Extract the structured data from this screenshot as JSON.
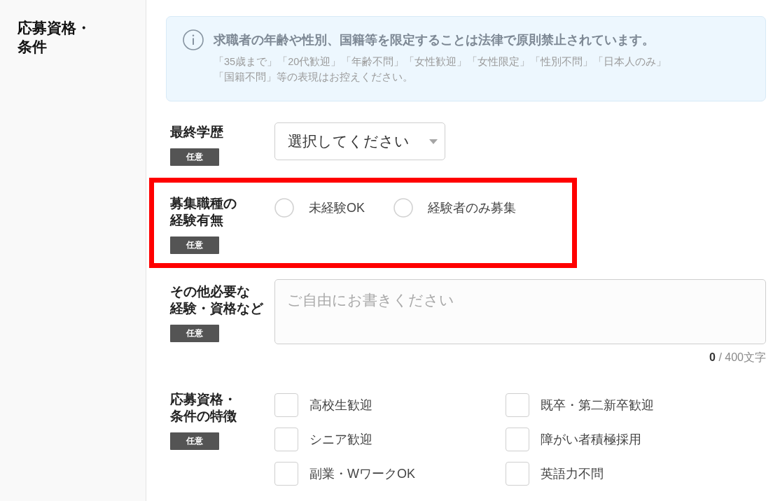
{
  "sidebar": {
    "title": "応募資格・条件"
  },
  "notice": {
    "heading": "求職者の年齢や性別、国籍等を限定することは法律で原則禁止されています。",
    "body": "「35歳まで」「20代歓迎」「年齢不問」「女性歓迎」「女性限定」「性別不問」「日本人のみ」「国籍不問」等の表現はお控えください。"
  },
  "fields": [
    {
      "kind": "select",
      "label_lines": [
        "最終学歴"
      ],
      "badge": "任意",
      "highlighted": false,
      "value": "選択してください"
    },
    {
      "kind": "radio",
      "label_lines": [
        "募集職種の",
        "経験有無"
      ],
      "badge": "任意",
      "highlighted": true,
      "options": [
        {
          "label": "未経験OK",
          "selected": false
        },
        {
          "label": "経験者のみ募集",
          "selected": false
        }
      ]
    },
    {
      "kind": "textarea",
      "label_lines": [
        "その他必要な",
        "経験・資格など"
      ],
      "badge": "任意",
      "highlighted": false,
      "placeholder": "ご自由にお書きください",
      "counter": "**0** / 400文字"
    },
    {
      "kind": "checkboxes",
      "label_lines": [
        "応募資格・",
        "条件の特徴"
      ],
      "badge": "任意",
      "highlighted": false,
      "options": [
        {
          "label": "高校生歓迎",
          "checked": false
        },
        {
          "label": "既卒・第二新卒歓迎",
          "checked": false
        },
        {
          "label": "シニア歓迎",
          "checked": false
        },
        {
          "label": "障がい者積極採用",
          "checked": false
        },
        {
          "label": "副業・WワークOK",
          "checked": false
        },
        {
          "label": "英語力不問",
          "checked": false
        }
      ]
    }
  ]
}
